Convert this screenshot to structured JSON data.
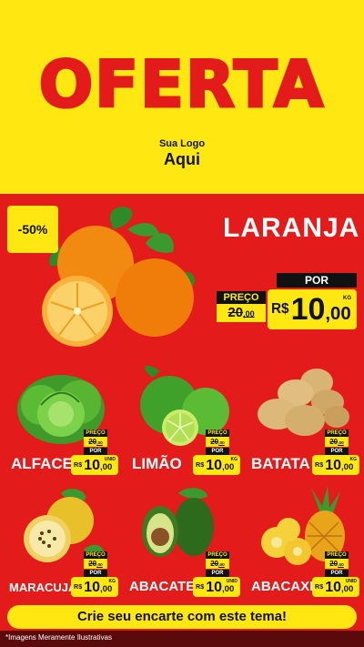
{
  "header": {
    "title": "OFERTA",
    "logo_line1": "Sua Logo",
    "logo_line2": "Aqui"
  },
  "hero": {
    "discount": "-50%",
    "name": "LARANJA",
    "por": "POR",
    "preco": "PREÇO",
    "old_int": "20",
    "old_dec": ",00",
    "currency": "R$",
    "price_int": "10",
    "price_dec": ",00",
    "unit": "KG"
  },
  "products": [
    {
      "name": "ALFACE",
      "unit": "UNID",
      "preco": "PREÇO",
      "old_int": "20",
      "old_dec": ",00",
      "por": "POR",
      "currency": "R$",
      "price_int": "10",
      "price_dec": ",00"
    },
    {
      "name": "LIMÃO",
      "unit": "KG",
      "preco": "PREÇO",
      "old_int": "20",
      "old_dec": ",00",
      "por": "POR",
      "currency": "R$",
      "price_int": "10",
      "price_dec": ",00"
    },
    {
      "name": "BATATA",
      "unit": "KG",
      "preco": "PREÇO",
      "old_int": "20",
      "old_dec": ",00",
      "por": "POR",
      "currency": "R$",
      "price_int": "10",
      "price_dec": ",00"
    },
    {
      "name": "MARACUJÁ",
      "unit": "KG",
      "preco": "PREÇO",
      "old_int": "20",
      "old_dec": ",00",
      "por": "POR",
      "currency": "R$",
      "price_int": "10",
      "price_dec": ",00"
    },
    {
      "name": "ABACATE",
      "unit": "UNID",
      "preco": "PREÇO",
      "old_int": "20",
      "old_dec": ",00",
      "por": "POR",
      "currency": "R$",
      "price_int": "10",
      "price_dec": ",00"
    },
    {
      "name": "ABACAXI",
      "unit": "UNID",
      "preco": "PREÇO",
      "old_int": "20",
      "old_dec": ",00",
      "por": "POR",
      "currency": "R$",
      "price_int": "10",
      "price_dec": ",00"
    }
  ],
  "banner": "Crie seu encarte com este tema!",
  "footer": "*Imagens Meramente Ilustrativas",
  "colors": {
    "yellow": "#ffe812",
    "red": "#e31b1b",
    "black": "#111111",
    "dark_red": "#5a0a0a"
  }
}
